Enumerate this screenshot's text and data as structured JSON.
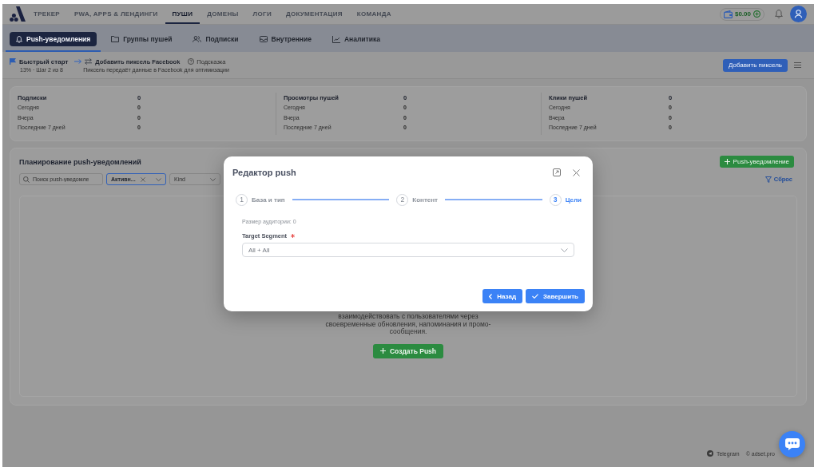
{
  "top_nav": {
    "items": [
      {
        "label": "ТРЕКЕР",
        "selected": false
      },
      {
        "label": "PWA, APPS & ЛЕНДИНГИ",
        "selected": false
      },
      {
        "label": "ПУШИ",
        "selected": true
      },
      {
        "label": "ДОМЕНЫ",
        "selected": false
      },
      {
        "label": "ЛОГИ",
        "selected": false
      },
      {
        "label": "ДОКУМЕНТАЦИЯ",
        "selected": false
      },
      {
        "label": "КОМАНДА",
        "selected": false
      }
    ],
    "balance": "$0.00"
  },
  "sub_nav": {
    "tabs": [
      {
        "label": "Push-уведомления",
        "selected": true
      },
      {
        "label": "Группы пушей",
        "selected": false
      },
      {
        "label": "Подписки",
        "selected": false
      },
      {
        "label": "Внутренние",
        "selected": false
      },
      {
        "label": "Аналитика",
        "selected": false
      }
    ]
  },
  "quick_start": {
    "title": "Быстрый старт",
    "progress": "13% · Шаг 2 из 8",
    "step": "Добавить пиксель Facebook",
    "hint": "Подсказка",
    "description": "Пиксель передаёт данные в Facebook для оптимизации",
    "button": "Добавить пиксель"
  },
  "stats": [
    {
      "title": "Подписки",
      "value": "0",
      "rows": [
        {
          "label": "Сегодня",
          "value": "0"
        },
        {
          "label": "Вчера",
          "value": "0"
        },
        {
          "label": "Последние 7 дней",
          "value": "0"
        }
      ]
    },
    {
      "title": "Просмотры пушей",
      "value": "0",
      "rows": [
        {
          "label": "Сегодня",
          "value": "0"
        },
        {
          "label": "Вчера",
          "value": "0"
        },
        {
          "label": "Последние 7 дней",
          "value": "0"
        }
      ]
    },
    {
      "title": "Клики пушей",
      "value": "0",
      "rows": [
        {
          "label": "Сегодня",
          "value": "0"
        },
        {
          "label": "Вчера",
          "value": "0"
        },
        {
          "label": "Последние 7 дней",
          "value": "0"
        }
      ]
    }
  ],
  "planning": {
    "title": "Планирование push-уведомлений",
    "add_button": "Push-уведомление",
    "search": {
      "placeholder": "Поиск push-уведомле"
    },
    "filters": [
      {
        "value": "Активн...",
        "active": true
      },
      {
        "placeholder": "Kind",
        "active": false
      }
    ],
    "reset": "Сброс",
    "empty_state": {
      "lines": [
        "взаимодействовать с пользователями через",
        "своевременные обновления, напоминания и промо-",
        "сообщения."
      ],
      "button": "Создать Push"
    }
  },
  "modal": {
    "title": "Редактор push",
    "steps": [
      {
        "number": "1",
        "label": "База и тип",
        "selected": false
      },
      {
        "number": "2",
        "label": "Контент",
        "selected": false
      },
      {
        "number": "3",
        "label": "Цели",
        "selected": true
      }
    ],
    "audience": "Размер аудитории: 0",
    "field": {
      "label": "Target Segment",
      "required": true,
      "value": "All + All"
    },
    "buttons": [
      {
        "label": "Назад",
        "kind": "back"
      },
      {
        "label": "Завершить",
        "kind": "finish"
      }
    ]
  },
  "footer": {
    "link": "Telegram",
    "copyright": "© adset.pro"
  }
}
